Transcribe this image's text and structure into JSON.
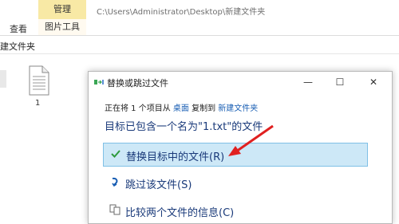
{
  "ribbon": {
    "manage_tab": "管理",
    "path": "C:\\Users\\Administrator\\Desktop\\新建文件夹",
    "view_tab": "查看",
    "picture_tools_tab": "图片工具"
  },
  "address_bar": {
    "text": "建文件夹"
  },
  "file": {
    "name": "1",
    "icon": "text-file-icon"
  },
  "dialog": {
    "title": "替换或跳过文件",
    "title_icon": "copy-files-icon",
    "minimize": "—",
    "maximize": "☐",
    "close": "✕",
    "copy_line": {
      "prefix": "正在将 1 个项目从",
      "source": "桌面",
      "middle": "复制到",
      "destination": "新建文件夹"
    },
    "headline": "目标已包含一个名为\"1.txt\"的文件",
    "options": [
      {
        "label": "替换目标中的文件(R)",
        "icon": "checkmark-icon"
      },
      {
        "label": "跳过该文件(S)",
        "icon": "skip-arrow-icon"
      },
      {
        "label": "比较两个文件的信息(C)",
        "icon": "compare-icon"
      }
    ]
  },
  "colors": {
    "manage_tab_bg": "#f8e9a5",
    "selected_option_bg": "#cde8f7",
    "selected_option_border": "#7fc0e6",
    "link": "#1a5fb4",
    "arrow": "#e02020"
  }
}
